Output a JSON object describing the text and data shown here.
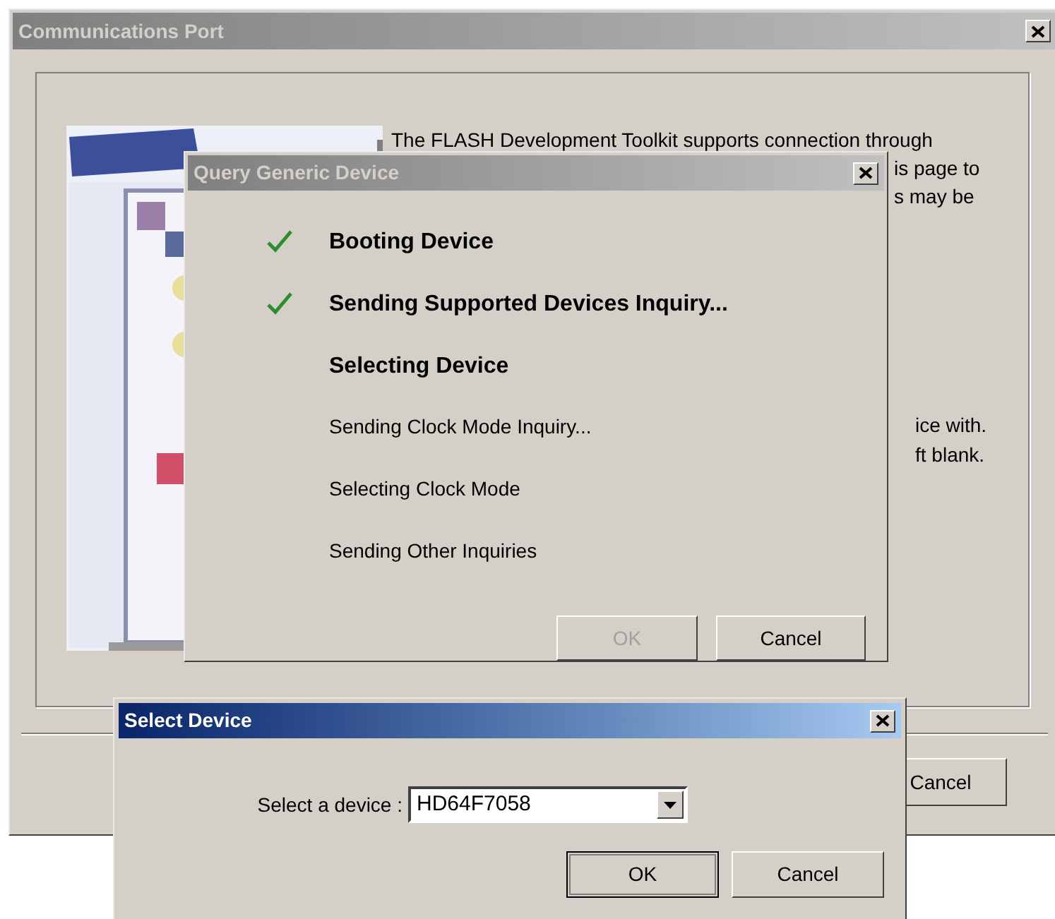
{
  "comm_window": {
    "title": "Communications Port",
    "active": false,
    "text_lines": [
      "The FLASH Development Toolkit supports connection through",
      "is page to",
      "s may be",
      "ice with.",
      "ft blank."
    ],
    "buttons": [
      {
        "label": "Cancel",
        "disabled": false
      }
    ]
  },
  "query_window": {
    "title": "Query Generic Device",
    "active": false,
    "steps": [
      {
        "label": "Booting Device",
        "done": true,
        "started": true
      },
      {
        "label": "Sending Supported Devices Inquiry...",
        "done": true,
        "started": true
      },
      {
        "label": "Selecting Device",
        "done": false,
        "started": true
      },
      {
        "label": "Sending Clock Mode Inquiry...",
        "done": false,
        "started": false
      },
      {
        "label": "Selecting Clock Mode",
        "done": false,
        "started": false
      },
      {
        "label": "Sending Other Inquiries",
        "done": false,
        "started": false
      }
    ],
    "buttons": [
      {
        "label": "OK",
        "disabled": true
      },
      {
        "label": "Cancel",
        "disabled": false
      }
    ]
  },
  "select_window": {
    "title": "Select Device",
    "active": true,
    "field_label": "Select a device :",
    "device": {
      "value": "HD64F7058"
    },
    "buttons": [
      {
        "label": "OK",
        "disabled": false,
        "default": true
      },
      {
        "label": "Cancel",
        "disabled": false,
        "default": false
      }
    ]
  }
}
